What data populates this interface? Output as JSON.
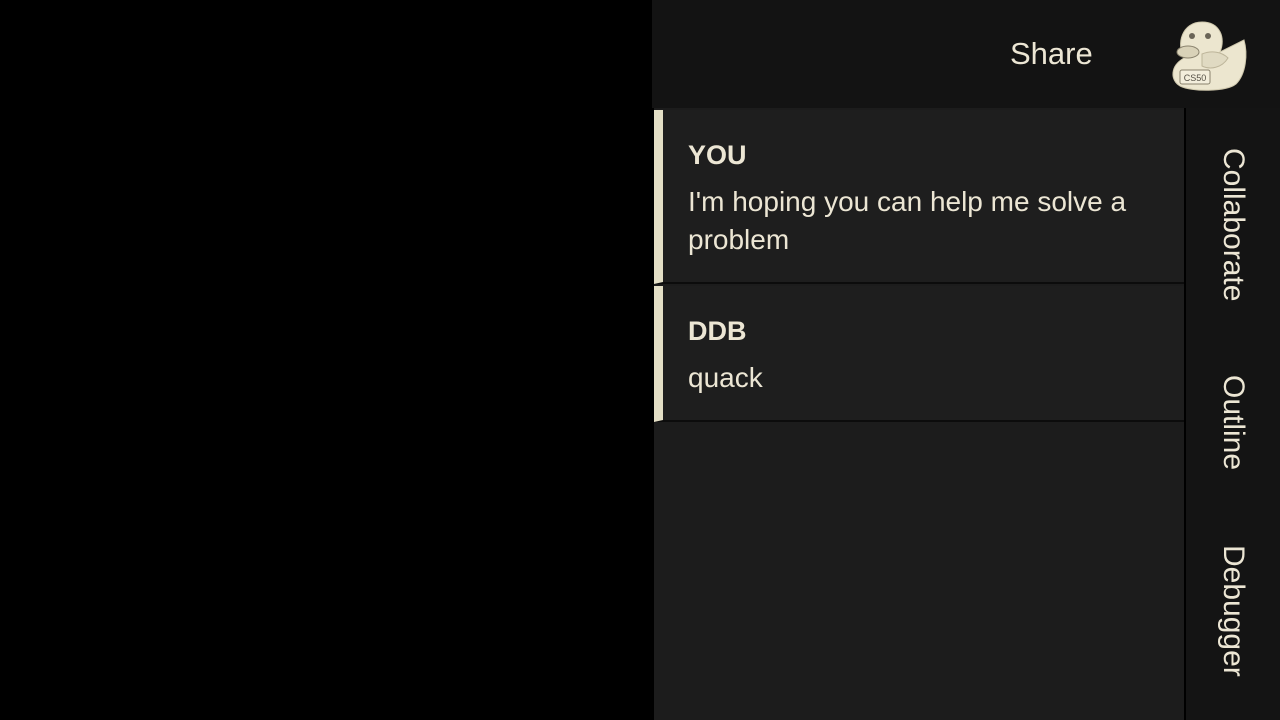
{
  "header": {
    "share_label": "Share",
    "logo_text": "CS50"
  },
  "messages": [
    {
      "author": "YOU",
      "text": "I'm hoping you can help me solve a problem"
    },
    {
      "author": "DDB",
      "text": "quack"
    }
  ],
  "side_tabs": [
    {
      "label": "Collaborate"
    },
    {
      "label": "Outline"
    },
    {
      "label": "Debugger"
    }
  ],
  "colors": {
    "accent": "#e4dfc6",
    "text": "#ece6d4",
    "panel": "#1e1e1e",
    "background": "#000000"
  },
  "icons": {
    "logo": "rubber-duck-icon"
  }
}
